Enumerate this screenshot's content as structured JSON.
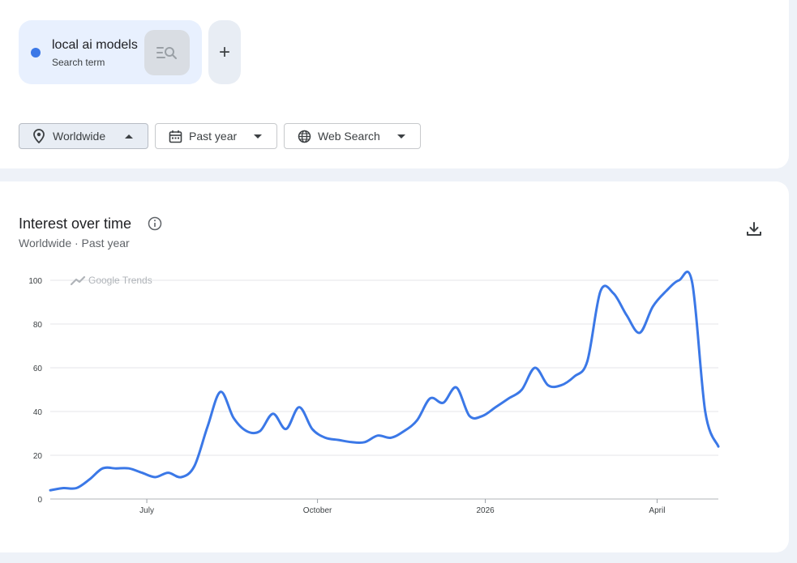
{
  "search_term": {
    "name": "local ai models",
    "label": "Search term",
    "color": "#3b78e7"
  },
  "add_button": {
    "label": "+"
  },
  "filters": {
    "region": "Worldwide",
    "time": "Past year",
    "property": "Web Search"
  },
  "chart_panel": {
    "title": "Interest over time",
    "subtitle": "Worldwide · Past year",
    "watermark": "Google Trends"
  },
  "chart_data": {
    "type": "line",
    "title": "Interest over time",
    "xlabel": "",
    "ylabel": "",
    "ylim": [
      0,
      100
    ],
    "y_ticks": [
      0,
      20,
      40,
      60,
      80,
      100
    ],
    "x_tick_labels": [
      "July",
      "October",
      "2026",
      "April"
    ],
    "grid": true,
    "series": [
      {
        "color": "#3b78e7",
        "values": [
          4,
          5,
          5,
          9,
          14,
          14,
          14,
          12,
          10,
          12,
          10,
          15,
          33,
          49,
          37,
          31,
          31,
          39,
          32,
          42,
          32,
          28,
          27,
          26,
          26,
          29,
          28,
          31,
          36,
          46,
          44,
          51,
          38,
          38,
          42,
          46,
          50,
          60,
          52,
          52,
          56,
          63,
          95,
          94,
          84,
          76,
          88,
          95,
          100,
          99,
          40,
          24
        ]
      }
    ]
  }
}
